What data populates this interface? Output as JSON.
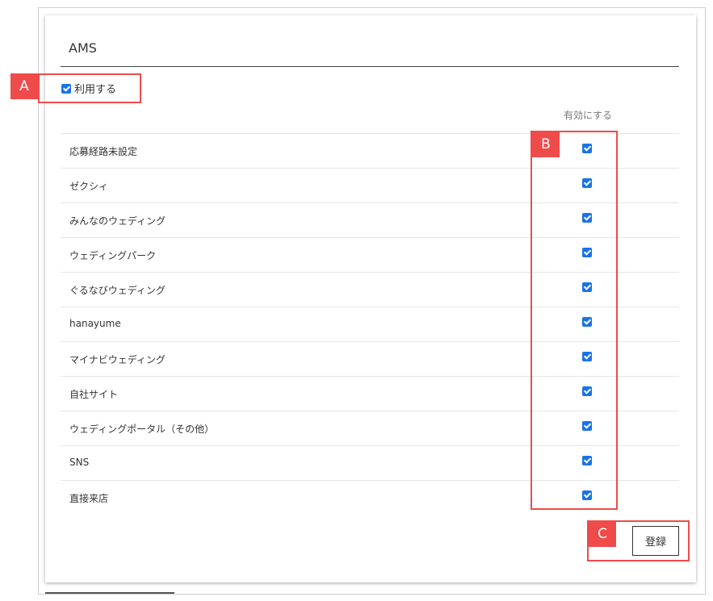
{
  "card": {
    "title": "AMS"
  },
  "use_toggle": {
    "label": "利用する",
    "checked": true
  },
  "table": {
    "column_header": "有効にする",
    "rows": [
      {
        "label": "応募経路未設定",
        "checked": true
      },
      {
        "label": "ゼクシィ",
        "checked": true
      },
      {
        "label": "みんなのウェディング",
        "checked": true
      },
      {
        "label": "ウェディングパーク",
        "checked": true
      },
      {
        "label": "ぐるなびウェディング",
        "checked": true
      },
      {
        "label": "hanayume",
        "checked": true
      },
      {
        "label": "マイナビウェディング",
        "checked": true
      },
      {
        "label": "自社サイト",
        "checked": true
      },
      {
        "label": "ウェディングポータル（その他）",
        "checked": true
      },
      {
        "label": "SNS",
        "checked": true
      },
      {
        "label": "直接来店",
        "checked": true
      }
    ]
  },
  "actions": {
    "register_label": "登録"
  },
  "annotations": {
    "a": "A",
    "b": "B",
    "c": "C",
    "color": "#ef4b4b"
  },
  "colors": {
    "checkbox": "#1a73e8"
  }
}
